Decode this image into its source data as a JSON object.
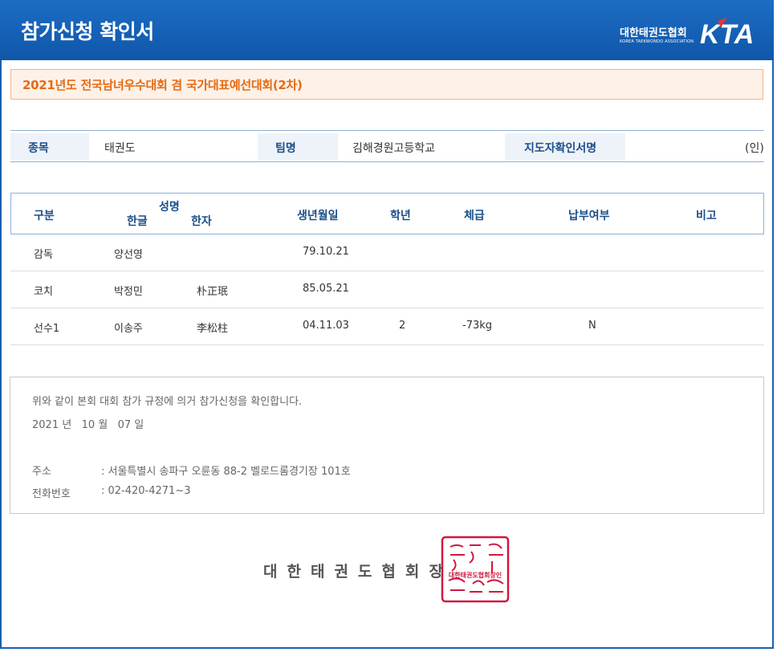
{
  "header": {
    "title": "참가신청 확인서",
    "logo_korean": "대한태권도협회",
    "logo_english": "KOREA TAEKWONDO ASSOCIATION",
    "logo_mark": "KTA"
  },
  "event": {
    "title": "2021년도 전국남녀우수대회 겸 국가대표예선대회(2차)"
  },
  "info": {
    "sport_label": "종목",
    "sport_value": "태권도",
    "team_label": "팀명",
    "team_value": "김해경원고등학교",
    "coach_sign_label": "지도자확인서명",
    "coach_sign_value": "(인)"
  },
  "roster": {
    "headers": {
      "category": "구분",
      "name": "성명",
      "name_korean": "한글",
      "name_hanja": "한자",
      "birthdate": "생년월일",
      "grade": "학년",
      "weight_class": "체급",
      "payment": "납부여부",
      "remarks": "비고"
    },
    "rows": [
      {
        "category": "감독",
        "name_korean": "양선영",
        "name_hanja": "",
        "birthdate": "79.10.21",
        "grade": "",
        "weight_class": "",
        "payment": "",
        "remarks": ""
      },
      {
        "category": "코치",
        "name_korean": "박정민",
        "name_hanja": "朴正珉",
        "birthdate": "85.05.21",
        "grade": "",
        "weight_class": "",
        "payment": "",
        "remarks": ""
      },
      {
        "category": "선수1",
        "name_korean": "이송주",
        "name_hanja": "李松柱",
        "birthdate": "04.11.03",
        "grade": "2",
        "weight_class": "-73kg",
        "payment": "N",
        "remarks": ""
      }
    ]
  },
  "notice": {
    "statement": "위와 같이 본회 대회 참가 규정에 의거 참가신청을 확인합니다.",
    "date": "2021 년   10 월   07 일",
    "address_label": "주소",
    "address_value": ": 서울특별시 송파구 오륜동 88-2 벨로드롬경기장 101호",
    "phone_label": "전화번호",
    "phone_value": ": 02-420-4271~3"
  },
  "signature": {
    "text": "대한태권도협회장",
    "seal_text": "대한태권도협회장인"
  },
  "colors": {
    "header_blue": "#1463ba",
    "event_orange": "#e66b12",
    "label_blue": "#1b4f8a",
    "seal_red": "#d0183f"
  }
}
